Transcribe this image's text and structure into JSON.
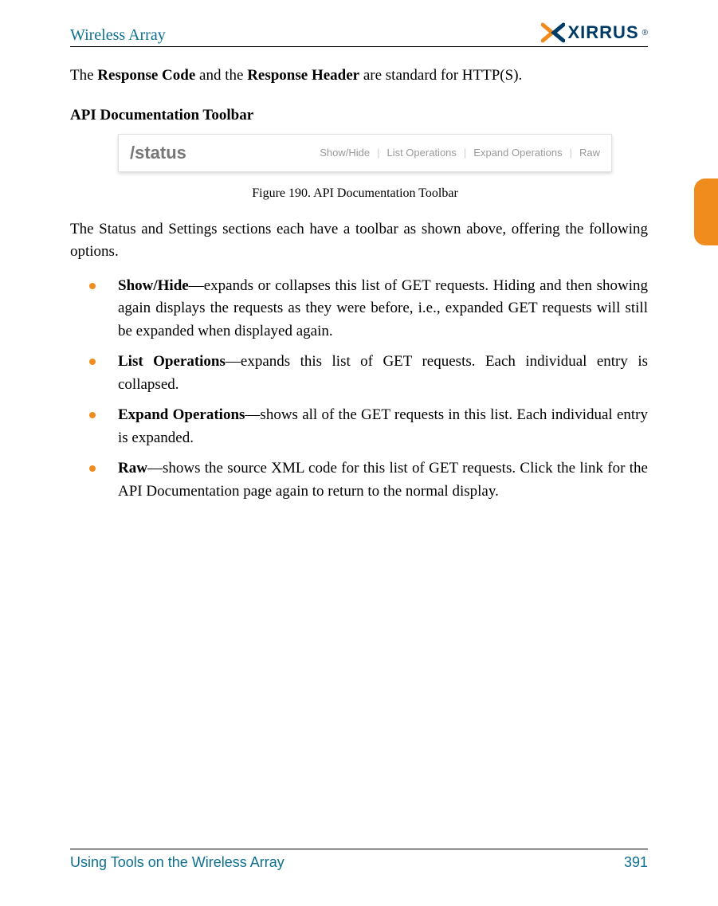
{
  "header": {
    "title": "Wireless Array",
    "logo_text": "XIRRUS",
    "logo_reg": "®"
  },
  "intro": {
    "pre": "The ",
    "b1": "Response Code",
    "mid": " and the ",
    "b2": "Response Header",
    "post": " are standard for HTTP(S)."
  },
  "section_heading": "API Documentation Toolbar",
  "toolbar": {
    "path": "/status",
    "links": [
      "Show/Hide",
      "List Operations",
      "Expand Operations",
      "Raw"
    ],
    "sep": "|"
  },
  "figure_caption": "Figure 190. API Documentation Toolbar",
  "body_para": "The Status and Settings sections each have a toolbar as shown above, offering the following options.",
  "bullets": [
    {
      "term": "Show/Hide",
      "desc": "—expands or collapses this list of GET requests. Hiding and then showing again displays the requests as they were before, i.e., expanded GET requests will still be expanded when displayed again."
    },
    {
      "term": "List Operations",
      "desc": "—expands this list of GET requests. Each individual entry is collapsed."
    },
    {
      "term": "Expand Operations",
      "desc": "—shows all of the GET requests in this list. Each individual entry is expanded."
    },
    {
      "term": "Raw",
      "desc": "—shows the source XML code for this list of GET requests. Click the link for the API Documentation page again to return to the normal display."
    }
  ],
  "footer": {
    "left": "Using Tools on the Wireless Array",
    "page": "391"
  }
}
